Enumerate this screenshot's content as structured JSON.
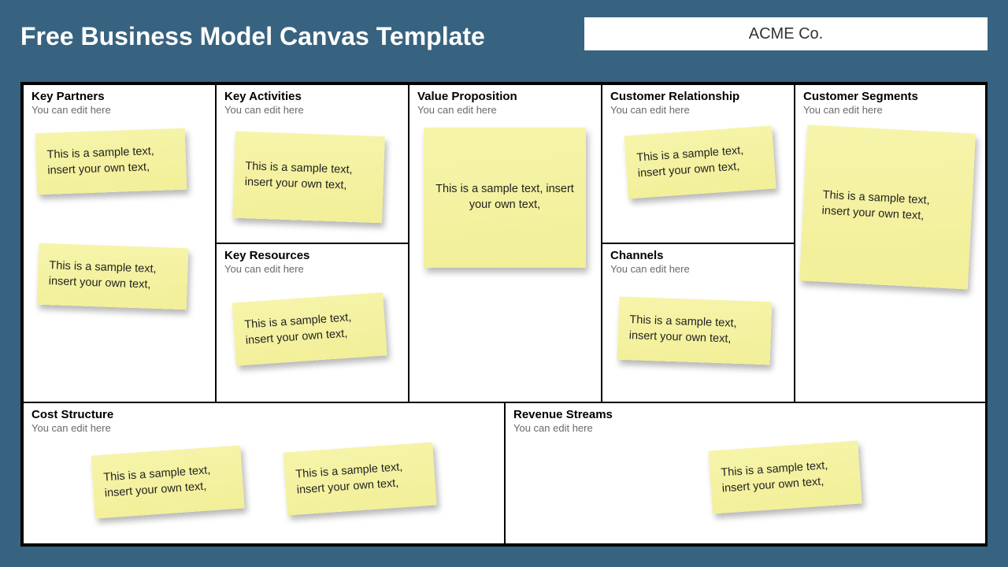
{
  "header": {
    "title": "Free Business Model Canvas Template",
    "company": "ACME Co."
  },
  "sections": {
    "key_partners": {
      "title": "Key Partners",
      "sub": "You can edit here"
    },
    "key_activities": {
      "title": "Key Activities",
      "sub": "You can edit here"
    },
    "value_prop": {
      "title": "Value Proposition",
      "sub": "You can edit here"
    },
    "cust_rel": {
      "title": "Customer Relationship",
      "sub": "You can edit here"
    },
    "cust_seg": {
      "title": "Customer Segments",
      "sub": "You can edit here"
    },
    "key_resources": {
      "title": "Key Resources",
      "sub": "You can edit here"
    },
    "channels": {
      "title": "Channels",
      "sub": "You can edit here"
    },
    "cost": {
      "title": "Cost Structure",
      "sub": "You can edit here"
    },
    "revenue": {
      "title": "Revenue Streams",
      "sub": "You can edit here"
    }
  },
  "note_text": "This is a sample text, insert your own text,"
}
